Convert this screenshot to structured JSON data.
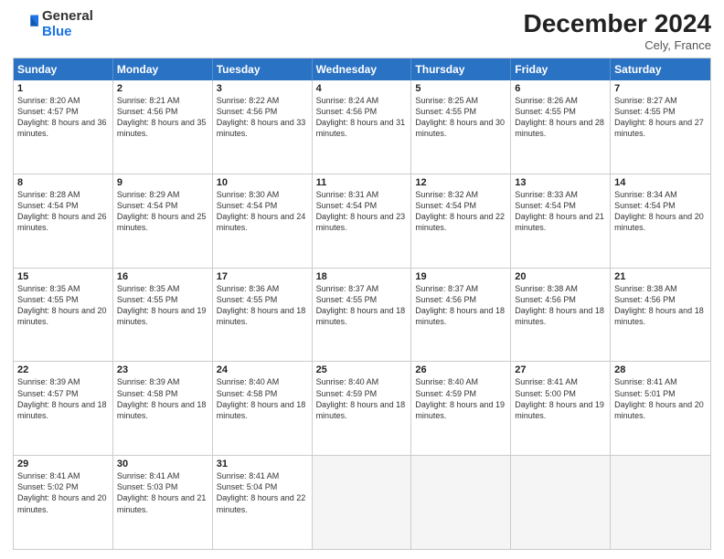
{
  "logo": {
    "general": "General",
    "blue": "Blue"
  },
  "title": "December 2024",
  "location": "Cely, France",
  "header": {
    "days": [
      "Sunday",
      "Monday",
      "Tuesday",
      "Wednesday",
      "Thursday",
      "Friday",
      "Saturday"
    ]
  },
  "weeks": [
    [
      {
        "day": "1",
        "sunrise": "8:20 AM",
        "sunset": "4:57 PM",
        "daylight": "8 hours and 36 minutes"
      },
      {
        "day": "2",
        "sunrise": "8:21 AM",
        "sunset": "4:56 PM",
        "daylight": "8 hours and 35 minutes"
      },
      {
        "day": "3",
        "sunrise": "8:22 AM",
        "sunset": "4:56 PM",
        "daylight": "8 hours and 33 minutes"
      },
      {
        "day": "4",
        "sunrise": "8:24 AM",
        "sunset": "4:56 PM",
        "daylight": "8 hours and 31 minutes"
      },
      {
        "day": "5",
        "sunrise": "8:25 AM",
        "sunset": "4:55 PM",
        "daylight": "8 hours and 30 minutes"
      },
      {
        "day": "6",
        "sunrise": "8:26 AM",
        "sunset": "4:55 PM",
        "daylight": "8 hours and 28 minutes"
      },
      {
        "day": "7",
        "sunrise": "8:27 AM",
        "sunset": "4:55 PM",
        "daylight": "8 hours and 27 minutes"
      }
    ],
    [
      {
        "day": "8",
        "sunrise": "8:28 AM",
        "sunset": "4:54 PM",
        "daylight": "8 hours and 26 minutes"
      },
      {
        "day": "9",
        "sunrise": "8:29 AM",
        "sunset": "4:54 PM",
        "daylight": "8 hours and 25 minutes"
      },
      {
        "day": "10",
        "sunrise": "8:30 AM",
        "sunset": "4:54 PM",
        "daylight": "8 hours and 24 minutes"
      },
      {
        "day": "11",
        "sunrise": "8:31 AM",
        "sunset": "4:54 PM",
        "daylight": "8 hours and 23 minutes"
      },
      {
        "day": "12",
        "sunrise": "8:32 AM",
        "sunset": "4:54 PM",
        "daylight": "8 hours and 22 minutes"
      },
      {
        "day": "13",
        "sunrise": "8:33 AM",
        "sunset": "4:54 PM",
        "daylight": "8 hours and 21 minutes"
      },
      {
        "day": "14",
        "sunrise": "8:34 AM",
        "sunset": "4:54 PM",
        "daylight": "8 hours and 20 minutes"
      }
    ],
    [
      {
        "day": "15",
        "sunrise": "8:35 AM",
        "sunset": "4:55 PM",
        "daylight": "8 hours and 20 minutes"
      },
      {
        "day": "16",
        "sunrise": "8:35 AM",
        "sunset": "4:55 PM",
        "daylight": "8 hours and 19 minutes"
      },
      {
        "day": "17",
        "sunrise": "8:36 AM",
        "sunset": "4:55 PM",
        "daylight": "8 hours and 18 minutes"
      },
      {
        "day": "18",
        "sunrise": "8:37 AM",
        "sunset": "4:55 PM",
        "daylight": "8 hours and 18 minutes"
      },
      {
        "day": "19",
        "sunrise": "8:37 AM",
        "sunset": "4:56 PM",
        "daylight": "8 hours and 18 minutes"
      },
      {
        "day": "20",
        "sunrise": "8:38 AM",
        "sunset": "4:56 PM",
        "daylight": "8 hours and 18 minutes"
      },
      {
        "day": "21",
        "sunrise": "8:38 AM",
        "sunset": "4:56 PM",
        "daylight": "8 hours and 18 minutes"
      }
    ],
    [
      {
        "day": "22",
        "sunrise": "8:39 AM",
        "sunset": "4:57 PM",
        "daylight": "8 hours and 18 minutes"
      },
      {
        "day": "23",
        "sunrise": "8:39 AM",
        "sunset": "4:58 PM",
        "daylight": "8 hours and 18 minutes"
      },
      {
        "day": "24",
        "sunrise": "8:40 AM",
        "sunset": "4:58 PM",
        "daylight": "8 hours and 18 minutes"
      },
      {
        "day": "25",
        "sunrise": "8:40 AM",
        "sunset": "4:59 PM",
        "daylight": "8 hours and 18 minutes"
      },
      {
        "day": "26",
        "sunrise": "8:40 AM",
        "sunset": "4:59 PM",
        "daylight": "8 hours and 19 minutes"
      },
      {
        "day": "27",
        "sunrise": "8:41 AM",
        "sunset": "5:00 PM",
        "daylight": "8 hours and 19 minutes"
      },
      {
        "day": "28",
        "sunrise": "8:41 AM",
        "sunset": "5:01 PM",
        "daylight": "8 hours and 20 minutes"
      }
    ],
    [
      {
        "day": "29",
        "sunrise": "8:41 AM",
        "sunset": "5:02 PM",
        "daylight": "8 hours and 20 minutes"
      },
      {
        "day": "30",
        "sunrise": "8:41 AM",
        "sunset": "5:03 PM",
        "daylight": "8 hours and 21 minutes"
      },
      {
        "day": "31",
        "sunrise": "8:41 AM",
        "sunset": "5:04 PM",
        "daylight": "8 hours and 22 minutes"
      },
      null,
      null,
      null,
      null
    ]
  ]
}
